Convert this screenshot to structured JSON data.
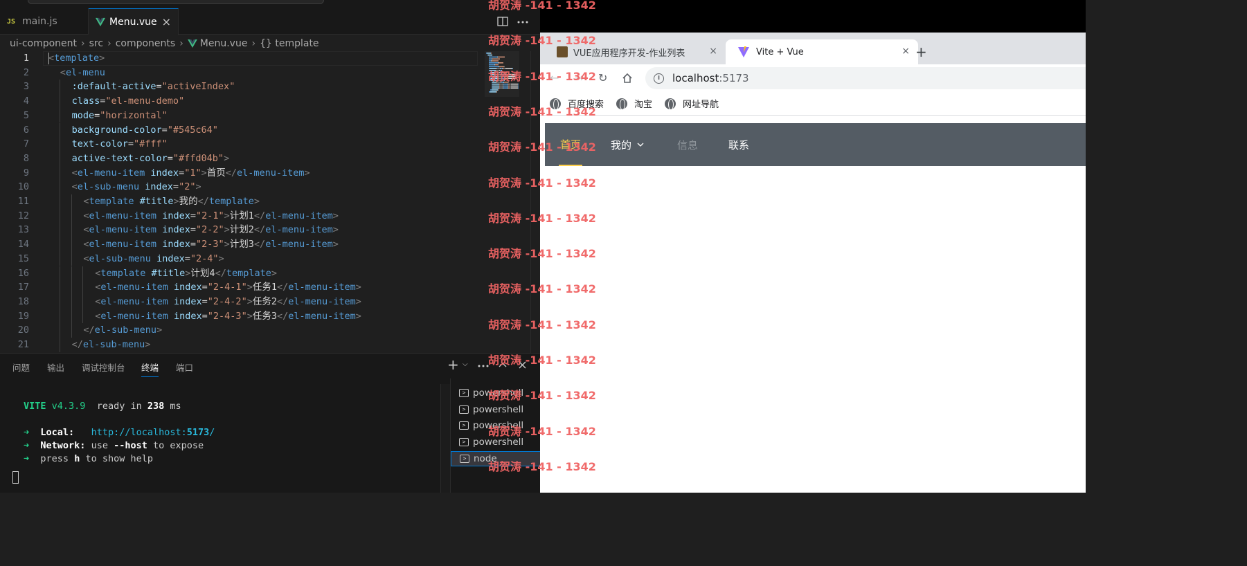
{
  "vscode": {
    "tabs": [
      {
        "badge": "JS",
        "label": "main.js"
      },
      {
        "label": "Menu.vue",
        "close": "×"
      }
    ],
    "breadcrumb": [
      "ui-component",
      "src",
      "components",
      "Menu.vue",
      "{} template"
    ],
    "code_lines": [
      {
        "n": "1",
        "indent": 0,
        "parts": [
          [
            "tg",
            "<"
          ],
          [
            "tn",
            "template"
          ],
          [
            "tg",
            ">"
          ]
        ]
      },
      {
        "n": "2",
        "indent": 1,
        "parts": [
          [
            "tg",
            "<"
          ],
          [
            "tn",
            "el-menu"
          ]
        ]
      },
      {
        "n": "3",
        "indent": 2,
        "parts": [
          [
            "an",
            ":default-active"
          ],
          [
            "tx",
            "="
          ],
          [
            "av",
            "\"activeIndex\""
          ]
        ]
      },
      {
        "n": "4",
        "indent": 2,
        "parts": [
          [
            "an",
            "class"
          ],
          [
            "tx",
            "="
          ],
          [
            "av",
            "\"el-menu-demo\""
          ]
        ]
      },
      {
        "n": "5",
        "indent": 2,
        "parts": [
          [
            "an",
            "mode"
          ],
          [
            "tx",
            "="
          ],
          [
            "av",
            "\"horizontal\""
          ]
        ]
      },
      {
        "n": "6",
        "indent": 2,
        "parts": [
          [
            "an",
            "background-color"
          ],
          [
            "tx",
            "="
          ],
          [
            "av",
            "\"#545c64\""
          ]
        ]
      },
      {
        "n": "7",
        "indent": 2,
        "parts": [
          [
            "an",
            "text-color"
          ],
          [
            "tx",
            "="
          ],
          [
            "av",
            "\"#fff\""
          ]
        ]
      },
      {
        "n": "8",
        "indent": 2,
        "parts": [
          [
            "an",
            "active-text-color"
          ],
          [
            "tx",
            "="
          ],
          [
            "av",
            "\"#ffd04b\""
          ],
          [
            "tg",
            ">"
          ]
        ]
      },
      {
        "n": "9",
        "indent": 2,
        "parts": [
          [
            "tg",
            "<"
          ],
          [
            "tn",
            "el-menu-item"
          ],
          [
            "tx",
            " "
          ],
          [
            "an",
            "index"
          ],
          [
            "tx",
            "="
          ],
          [
            "av",
            "\"1\""
          ],
          [
            "tg",
            ">"
          ],
          [
            "tx",
            "首页"
          ],
          [
            "tg",
            "</"
          ],
          [
            "tn",
            "el-menu-item"
          ],
          [
            "tg",
            ">"
          ]
        ]
      },
      {
        "n": "10",
        "indent": 2,
        "parts": [
          [
            "tg",
            "<"
          ],
          [
            "tn",
            "el-sub-menu"
          ],
          [
            "tx",
            " "
          ],
          [
            "an",
            "index"
          ],
          [
            "tx",
            "="
          ],
          [
            "av",
            "\"2\""
          ],
          [
            "tg",
            ">"
          ]
        ]
      },
      {
        "n": "11",
        "indent": 3,
        "parts": [
          [
            "tg",
            "<"
          ],
          [
            "tn",
            "template"
          ],
          [
            "tx",
            " "
          ],
          [
            "an",
            "#title"
          ],
          [
            "tg",
            ">"
          ],
          [
            "tx",
            "我的"
          ],
          [
            "tg",
            "</"
          ],
          [
            "tn",
            "template"
          ],
          [
            "tg",
            ">"
          ]
        ]
      },
      {
        "n": "12",
        "indent": 3,
        "parts": [
          [
            "tg",
            "<"
          ],
          [
            "tn",
            "el-menu-item"
          ],
          [
            "tx",
            " "
          ],
          [
            "an",
            "index"
          ],
          [
            "tx",
            "="
          ],
          [
            "av",
            "\"2-1\""
          ],
          [
            "tg",
            ">"
          ],
          [
            "tx",
            "计划1"
          ],
          [
            "tg",
            "</"
          ],
          [
            "tn",
            "el-menu-item"
          ],
          [
            "tg",
            ">"
          ]
        ]
      },
      {
        "n": "13",
        "indent": 3,
        "parts": [
          [
            "tg",
            "<"
          ],
          [
            "tn",
            "el-menu-item"
          ],
          [
            "tx",
            " "
          ],
          [
            "an",
            "index"
          ],
          [
            "tx",
            "="
          ],
          [
            "av",
            "\"2-2\""
          ],
          [
            "tg",
            ">"
          ],
          [
            "tx",
            "计划2"
          ],
          [
            "tg",
            "</"
          ],
          [
            "tn",
            "el-menu-item"
          ],
          [
            "tg",
            ">"
          ]
        ]
      },
      {
        "n": "14",
        "indent": 3,
        "parts": [
          [
            "tg",
            "<"
          ],
          [
            "tn",
            "el-menu-item"
          ],
          [
            "tx",
            " "
          ],
          [
            "an",
            "index"
          ],
          [
            "tx",
            "="
          ],
          [
            "av",
            "\"2-3\""
          ],
          [
            "tg",
            ">"
          ],
          [
            "tx",
            "计划3"
          ],
          [
            "tg",
            "</"
          ],
          [
            "tn",
            "el-menu-item"
          ],
          [
            "tg",
            ">"
          ]
        ]
      },
      {
        "n": "15",
        "indent": 3,
        "parts": [
          [
            "tg",
            "<"
          ],
          [
            "tn",
            "el-sub-menu"
          ],
          [
            "tx",
            " "
          ],
          [
            "an",
            "index"
          ],
          [
            "tx",
            "="
          ],
          [
            "av",
            "\"2-4\""
          ],
          [
            "tg",
            ">"
          ]
        ]
      },
      {
        "n": "16",
        "indent": 4,
        "parts": [
          [
            "tg",
            "<"
          ],
          [
            "tn",
            "template"
          ],
          [
            "tx",
            " "
          ],
          [
            "an",
            "#title"
          ],
          [
            "tg",
            ">"
          ],
          [
            "tx",
            "计划4"
          ],
          [
            "tg",
            "</"
          ],
          [
            "tn",
            "template"
          ],
          [
            "tg",
            ">"
          ]
        ]
      },
      {
        "n": "17",
        "indent": 4,
        "parts": [
          [
            "tg",
            "<"
          ],
          [
            "tn",
            "el-menu-item"
          ],
          [
            "tx",
            " "
          ],
          [
            "an",
            "index"
          ],
          [
            "tx",
            "="
          ],
          [
            "av",
            "\"2-4-1\""
          ],
          [
            "tg",
            ">"
          ],
          [
            "tx",
            "任务1"
          ],
          [
            "tg",
            "</"
          ],
          [
            "tn",
            "el-menu-item"
          ],
          [
            "tg",
            ">"
          ]
        ]
      },
      {
        "n": "18",
        "indent": 4,
        "parts": [
          [
            "tg",
            "<"
          ],
          [
            "tn",
            "el-menu-item"
          ],
          [
            "tx",
            " "
          ],
          [
            "an",
            "index"
          ],
          [
            "tx",
            "="
          ],
          [
            "av",
            "\"2-4-2\""
          ],
          [
            "tg",
            ">"
          ],
          [
            "tx",
            "任务2"
          ],
          [
            "tg",
            "</"
          ],
          [
            "tn",
            "el-menu-item"
          ],
          [
            "tg",
            ">"
          ]
        ]
      },
      {
        "n": "19",
        "indent": 4,
        "parts": [
          [
            "tg",
            "<"
          ],
          [
            "tn",
            "el-menu-item"
          ],
          [
            "tx",
            " "
          ],
          [
            "an",
            "index"
          ],
          [
            "tx",
            "="
          ],
          [
            "av",
            "\"2-4-3\""
          ],
          [
            "tg",
            ">"
          ],
          [
            "tx",
            "任务3"
          ],
          [
            "tg",
            "</"
          ],
          [
            "tn",
            "el-menu-item"
          ],
          [
            "tg",
            ">"
          ]
        ]
      },
      {
        "n": "20",
        "indent": 3,
        "parts": [
          [
            "tg",
            "</"
          ],
          [
            "tn",
            "el-sub-menu"
          ],
          [
            "tg",
            ">"
          ]
        ]
      },
      {
        "n": "21",
        "indent": 2,
        "parts": [
          [
            "tg",
            "</"
          ],
          [
            "tn",
            "el-sub-menu"
          ],
          [
            "tg",
            ">"
          ]
        ]
      }
    ],
    "panel": {
      "tabs": [
        "问题",
        "输出",
        "调试控制台",
        "终端",
        "端口"
      ],
      "active_tab": "终端"
    },
    "terminal": {
      "vite_name": "VITE",
      "vite_version": "v4.3.9",
      "ready_text": "ready in",
      "ready_ms": "238",
      "ms_unit": "ms",
      "arrow": "➜",
      "local_label": "Local:",
      "local_url_prefix": "http://localhost:",
      "local_port": "5173",
      "local_url_suffix": "/",
      "network_label": "Network:",
      "network_use": "use",
      "network_flag": "--host",
      "network_rest": "to expose",
      "help_prefix": "press",
      "help_key": "h",
      "help_rest": "to show help"
    },
    "terminal_list": [
      "powershell",
      "powershell",
      "powershell",
      "powershell",
      "node"
    ],
    "terminal_selected_index": 4
  },
  "browser": {
    "tabs": [
      {
        "label": "VUE应用程序开发-作业列表"
      },
      {
        "label": "Vite + Vue"
      }
    ],
    "close_glyph": "×",
    "new_tab_glyph": "+",
    "url_host": "localhost",
    "url_port": ":5173",
    "bookmarks": [
      "百度搜索",
      "淘宝",
      "网址导航"
    ],
    "app_menu": {
      "background": "#545c64",
      "text_color": "#fff",
      "active_text_color": "#ffd04b",
      "items": [
        {
          "label": "首页",
          "state": "active"
        },
        {
          "label": "我的",
          "state": "submenu"
        },
        {
          "label": "信息",
          "state": "disabled"
        },
        {
          "label": "联系",
          "state": "normal"
        }
      ]
    }
  },
  "watermark": "胡贺涛 -141 - 1342"
}
